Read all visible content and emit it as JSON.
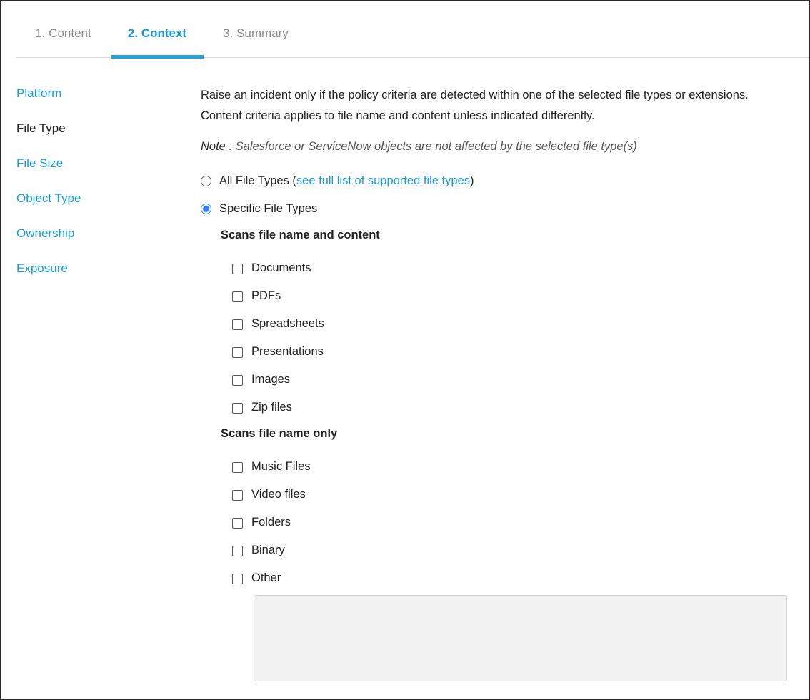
{
  "tabs": [
    {
      "label": "1. Content"
    },
    {
      "label": "2. Context"
    },
    {
      "label": "3. Summary"
    }
  ],
  "sidebar": {
    "items": [
      {
        "label": "Platform"
      },
      {
        "label": "File Type"
      },
      {
        "label": "File Size"
      },
      {
        "label": "Object Type"
      },
      {
        "label": "Ownership"
      },
      {
        "label": "Exposure"
      }
    ],
    "active": "File Type"
  },
  "main": {
    "description": "Raise an incident only if the policy criteria are detected within one of the selected file types or extensions. Content criteria applies to file name and content unless indicated differently.",
    "note_label": "Note",
    "note_text": " : Salesforce or ServiceNow objects are not affected by the selected file type(s)",
    "radio_all": {
      "label": "All File Types (",
      "link": "see full list of supported file types",
      "suffix": ")",
      "selected": false
    },
    "radio_specific": {
      "label": "Specific File Types",
      "selected": true
    },
    "section_content": {
      "title": "Scans file name and content",
      "options": [
        {
          "label": "Documents",
          "checked": false
        },
        {
          "label": "PDFs",
          "checked": false
        },
        {
          "label": "Spreadsheets",
          "checked": false
        },
        {
          "label": "Presentations",
          "checked": false
        },
        {
          "label": "Images",
          "checked": false
        },
        {
          "label": "Zip files",
          "checked": false
        }
      ]
    },
    "section_name": {
      "title": "Scans file name only",
      "options": [
        {
          "label": "Music Files",
          "checked": false
        },
        {
          "label": "Video files",
          "checked": false
        },
        {
          "label": "Folders",
          "checked": false
        },
        {
          "label": "Binary",
          "checked": false
        },
        {
          "label": "Other",
          "checked": false
        }
      ]
    },
    "other_text": ""
  },
  "colors": {
    "accent": "#1b9ad6",
    "tab_underline": "#2c9fd9",
    "radio_selected": "#3478f6"
  }
}
